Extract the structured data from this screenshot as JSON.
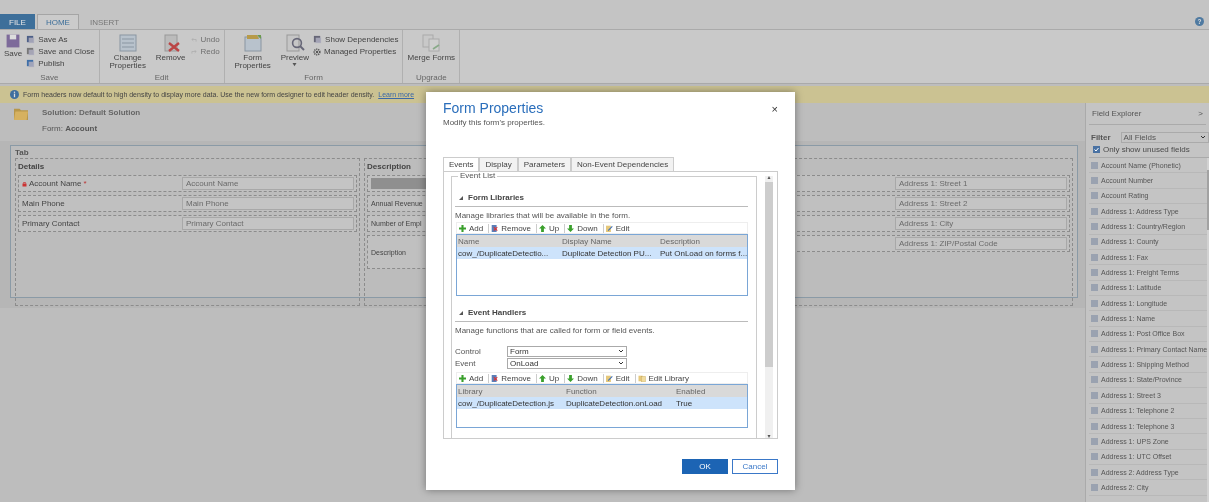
{
  "ribbon": {
    "tabs": [
      {
        "label": "FILE",
        "selected": false,
        "kind": "file"
      },
      {
        "label": "HOME",
        "selected": true,
        "kind": "tab"
      },
      {
        "label": "INSERT",
        "selected": false,
        "kind": "tab"
      }
    ],
    "help": "?",
    "groups": [
      {
        "label": "Save",
        "large": [
          {
            "label": "Save",
            "caret": false
          }
        ],
        "small": [
          {
            "label": "Save As",
            "disabled": false
          },
          {
            "label": "Save and Close",
            "disabled": false
          },
          {
            "label": "Publish",
            "disabled": false
          }
        ]
      },
      {
        "label": "Edit",
        "large": [
          {
            "label": "Change Properties",
            "caret": false
          },
          {
            "label": "Remove",
            "caret": false
          }
        ],
        "small": [
          {
            "label": "Undo",
            "disabled": true
          },
          {
            "label": "Redo",
            "disabled": true
          }
        ]
      },
      {
        "label": "Form",
        "large": [
          {
            "label": "Form Properties",
            "caret": false
          },
          {
            "label": "Preview",
            "caret": true
          }
        ],
        "small": [
          {
            "label": "Show Dependencies",
            "disabled": false
          },
          {
            "label": "Managed Properties",
            "disabled": false
          }
        ]
      },
      {
        "label": "Upgrade",
        "large": [
          {
            "label": "Merge Forms",
            "caret": false
          }
        ]
      }
    ]
  },
  "banner": {
    "text": "Form headers now default to high density to display more data. Use the new form designer to edit header density.",
    "link": "Learn more"
  },
  "header": {
    "solution": "Solution: Default Solution",
    "form_label": "Form:",
    "form_name": "Account"
  },
  "canvas": {
    "tab_label": "Tab",
    "sections": [
      {
        "title": "Details",
        "rows": [
          {
            "kind": "field",
            "label": "Account Name",
            "required_mark": "*",
            "locked": true,
            "placeholder": "Account Name"
          },
          {
            "kind": "field",
            "label": "Main Phone",
            "locked": false,
            "placeholder": "Main Phone"
          },
          {
            "kind": "field",
            "label": "Primary Contact",
            "locked": false,
            "placeholder": "Primary Contact"
          }
        ]
      },
      {
        "title": "Description",
        "rows": [
          {
            "kind": "bar"
          },
          {
            "kind": "label",
            "label": "Annual Revenue"
          },
          {
            "kind": "label",
            "label": "Number of Empl"
          },
          {
            "kind": "tall",
            "label": "Description"
          }
        ]
      },
      {
        "rows": [
          {
            "kind": "input",
            "placeholder": "Address 1: Street 1"
          },
          {
            "kind": "input",
            "placeholder": "Address 1: Street 2"
          },
          {
            "kind": "input",
            "placeholder": "Address 1: City"
          },
          {
            "kind": "input",
            "placeholder": "Address 1: ZIP/Postal Code"
          }
        ]
      }
    ]
  },
  "field_explorer": {
    "title": "Field Explorer",
    "collapse": ">",
    "filter_label": "Filter",
    "filter_value": "All Fields",
    "unused_only": {
      "label": "Only show unused fields",
      "checked": true
    },
    "fields": [
      "Account Name (Phonetic)",
      "Account Number",
      "Account Rating",
      "Address 1: Address Type",
      "Address 1: Country/Region",
      "Address 1: County",
      "Address 1: Fax",
      "Address 1: Freight Terms",
      "Address 1: Latitude",
      "Address 1: Longitude",
      "Address 1: Name",
      "Address 1: Post Office Box",
      "Address 1: Primary Contact Name",
      "Address 1: Shipping Method",
      "Address 1: State/Province",
      "Address 1: Street 3",
      "Address 1: Telephone 2",
      "Address 1: Telephone 3",
      "Address 1: UPS Zone",
      "Address 1: UTC Offset",
      "Address 2: Address Type",
      "Address 2: City"
    ]
  },
  "dialog": {
    "title": "Form Properties",
    "subtitle": "Modify this form's properties.",
    "close": "×",
    "tabs": [
      {
        "label": "Events",
        "selected": true
      },
      {
        "label": "Display",
        "selected": false
      },
      {
        "label": "Parameters",
        "selected": false
      },
      {
        "label": "Non-Event Dependencies",
        "selected": false
      }
    ],
    "legend": "Event List",
    "libraries": {
      "title": "Form Libraries",
      "description": "Manage libraries that will be available in the form.",
      "toolbar": [
        "Add",
        "Remove",
        "Up",
        "Down",
        "Edit"
      ],
      "columns": [
        "Name",
        "Display Name",
        "Description"
      ],
      "rows": [
        {
          "cells": [
            "cow_/DuplicateDetectio...",
            "Duplicate Detection PU...",
            "Put OnLoad on forms f..."
          ],
          "selected": true
        }
      ]
    },
    "handlers": {
      "title": "Event Handlers",
      "description": "Manage functions that are called for form or field events.",
      "control_label": "Control",
      "control_value": "Form",
      "event_label": "Event",
      "event_value": "OnLoad",
      "toolbar": [
        "Add",
        "Remove",
        "Up",
        "Down",
        "Edit",
        "Edit Library"
      ],
      "columns": [
        "Library",
        "Function",
        "Enabled"
      ],
      "rows": [
        {
          "cells": [
            "cow_/DuplicateDetection.js",
            "DuplicateDetection.onLoad",
            "True"
          ],
          "selected": true
        }
      ]
    },
    "buttons": [
      {
        "label": "OK",
        "kind": "primary"
      },
      {
        "label": "Cancel",
        "kind": "secondary"
      }
    ]
  }
}
